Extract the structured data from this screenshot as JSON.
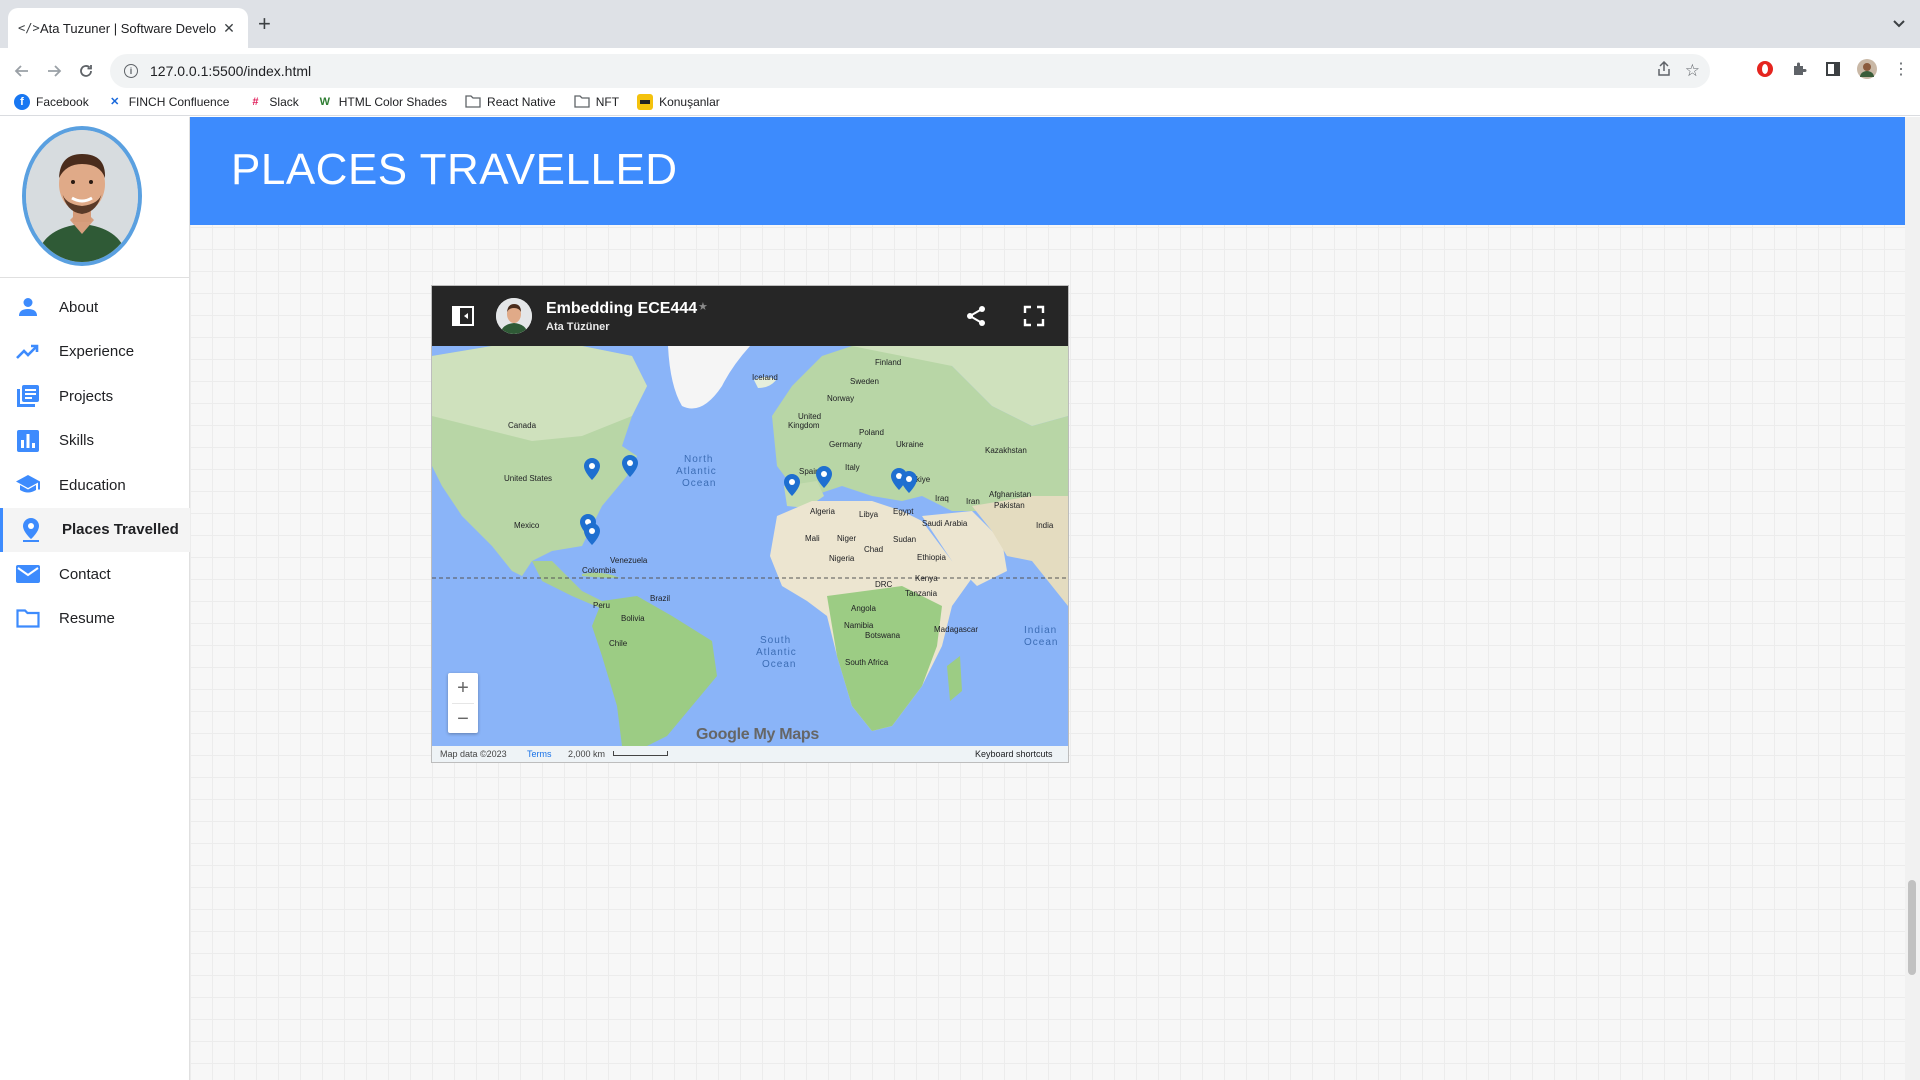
{
  "browser": {
    "tab_title": "Ata Tuzuner | Software Develo",
    "tab_icon": "code-icon",
    "url": "127.0.0.1:5500/index.html",
    "bookmarks": [
      {
        "label": "Facebook",
        "icon": "facebook-icon",
        "color": "#1877f2"
      },
      {
        "label": "FINCH Confluence",
        "icon": "confluence-icon",
        "color": "#1868db"
      },
      {
        "label": "Slack",
        "icon": "slack-icon",
        "color": "#e01e5a"
      },
      {
        "label": "HTML Color Shades",
        "icon": "w-icon",
        "color": "#2e7d32"
      },
      {
        "label": "React Native",
        "icon": "folder-icon",
        "color": "#5f6368"
      },
      {
        "label": "NFT",
        "icon": "folder-icon",
        "color": "#5f6368"
      },
      {
        "label": "Konuşanlar",
        "icon": "konusanlar-icon",
        "color": "#f4c20d"
      }
    ]
  },
  "sidebar": {
    "items": [
      {
        "label": "About",
        "icon": "person-icon"
      },
      {
        "label": "Experience",
        "icon": "trending-up-icon"
      },
      {
        "label": "Projects",
        "icon": "list-icon"
      },
      {
        "label": "Skills",
        "icon": "bar-chart-icon"
      },
      {
        "label": "Education",
        "icon": "school-icon"
      },
      {
        "label": "Places Travelled",
        "icon": "location-pin-icon",
        "active": true
      },
      {
        "label": "Contact",
        "icon": "mail-icon"
      },
      {
        "label": "Resume",
        "icon": "folder-icon"
      }
    ],
    "accent": "#3d8bfd"
  },
  "page": {
    "title": "PLACES TRAVELLED",
    "header_color": "#3d8bfd"
  },
  "map": {
    "title": "Embedding ECE444",
    "owner": "Ata Tüzüner",
    "footer": {
      "data": "Map data ©2023",
      "terms": "Terms",
      "scale": "2,000 km",
      "shortcuts": "Keyboard shortcuts"
    },
    "logo_text": "Google My Maps",
    "ocean_labels": [
      "North Atlantic Ocean",
      "South Atlantic Ocean",
      "Indian Ocean"
    ],
    "country_labels": [
      "Finland",
      "Iceland",
      "Sweden",
      "Norway",
      "United Kingdom",
      "Canada",
      "Germany",
      "Poland",
      "Ukraine",
      "Kazakhstan",
      "United States",
      "Spain",
      "Italy",
      "Türkiye",
      "Iraq",
      "Iran",
      "Afghanistan",
      "Pakistan",
      "India",
      "Mexico",
      "Algeria",
      "Libya",
      "Egypt",
      "Saudi Arabia",
      "Mali",
      "Niger",
      "Chad",
      "Sudan",
      "Nigeria",
      "Ethiopia",
      "Venezuela",
      "Colombia",
      "Kenya",
      "DRC",
      "Tanzania",
      "Peru",
      "Brazil",
      "Bolivia",
      "Angola",
      "Chile",
      "Namibia",
      "Madagascar",
      "Botswana",
      "South Africa"
    ],
    "markers": 8
  }
}
